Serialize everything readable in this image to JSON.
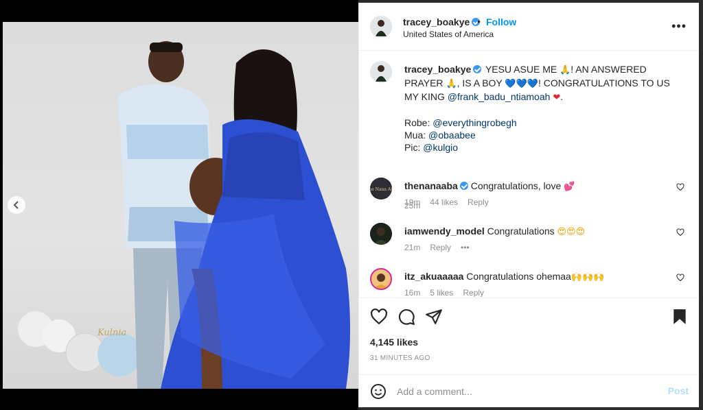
{
  "post": {
    "username": "tracey_boakye",
    "follow_label": "Follow",
    "location": "United States of America",
    "more_label": "•••",
    "separator": "•",
    "watermark": "Kulnia",
    "carousel": {
      "total_slides": 8,
      "active_index": 7
    }
  },
  "caption": {
    "username": "tracey_boakye",
    "part1": "YESU ASUE ME ",
    "pray1": "🙏",
    "part2": "! AN ANSWERED PRAYER ",
    "pray2": "🙏",
    "part3": ", IS A BOY ",
    "hearts": "💙💙💙",
    "part4": "! CONGRATULATIONS TO US MY KING ",
    "mention": "@frank_badu_ntiamoah",
    "heart": "❤",
    "end": ".",
    "robe_label": "Robe: ",
    "robe_mention": "@everythingrobegh",
    "mua_label": "Mua: ",
    "mua_mention": "@obaabee",
    "pic_label": "Pic: ",
    "pic_mention": "@kulgio",
    "time": "25m"
  },
  "comments": [
    {
      "username": "thenanaaba",
      "verified": true,
      "text": "Congratulations, love ",
      "emoji": "💕",
      "time": "19m",
      "likes": "44 likes",
      "reply": "Reply",
      "avatar_color": "#2e2e34"
    },
    {
      "username": "iamwendy_model",
      "verified": false,
      "text": "Congratulations ",
      "emoji": "😍😍😍",
      "time": "21m",
      "reply": "Reply",
      "more": "•••",
      "avatar_color": "#1e2a1e"
    },
    {
      "username": "itz_akuaaaaa",
      "verified": false,
      "text": "Congratulations ohemaa",
      "emoji": "🙌🙌🙌",
      "time": "16m",
      "likes": "5 likes",
      "reply": "Reply",
      "avatar_color": "#e7a23a"
    }
  ],
  "stats": {
    "likes": "4,145 likes",
    "time_ago": "31 MINUTES AGO"
  },
  "add_comment": {
    "placeholder": "Add a comment...",
    "post_label": "Post"
  },
  "colors": {
    "link": "#00376b",
    "follow": "#0095f6",
    "verified": "#3897f0",
    "muted": "#8e8e8e"
  }
}
